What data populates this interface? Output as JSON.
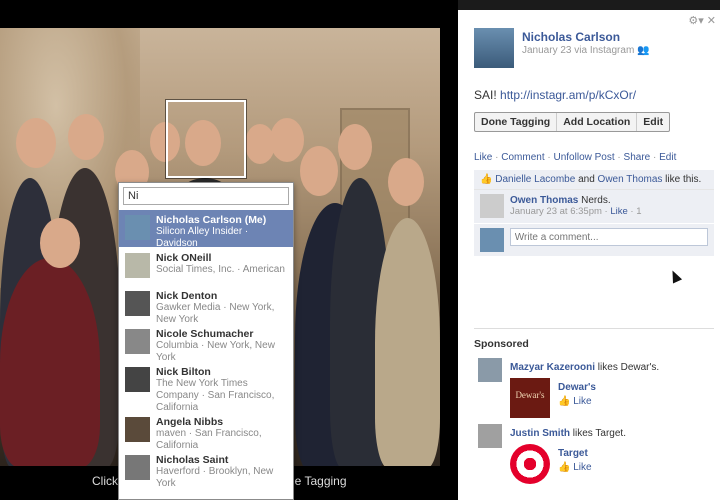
{
  "photo": {
    "caption_left": "Click",
    "caption_right": "ne Tagging"
  },
  "tag_dropdown": {
    "search_value": "Ni",
    "suggestions": [
      {
        "name": "Nicholas Carlson (Me)",
        "sub": "Silicon Alley Insider · Davidson"
      },
      {
        "name": "Nick ONeill",
        "sub": "Social Times, Inc. · American"
      },
      {
        "name": "Nick Denton",
        "sub": "Gawker Media · New York, New York"
      },
      {
        "name": "Nicole Schumacher",
        "sub": "Columbia · New York, New York"
      },
      {
        "name": "Nick Bilton",
        "sub": "The New York Times Company · San Francisco, California"
      },
      {
        "name": "Angela Nibbs",
        "sub": "maven · San Francisco, California"
      },
      {
        "name": "Nicholas Saint",
        "sub": "Haverford · Brooklyn, New York"
      }
    ]
  },
  "side": {
    "top_icons": "⚙▾  ✕",
    "author": "Nicholas Carlson",
    "meta": "January 23 via Instagram",
    "post_prefix": "SAI! ",
    "post_link": "http://instagr.am/p/kCxOr/",
    "buttons": [
      "Done Tagging",
      "Add Location",
      "Edit"
    ],
    "actions": [
      "Like",
      "Comment",
      "Unfollow Post",
      "Share",
      "Edit"
    ],
    "likes": {
      "name1": "Danielle Lacombe",
      "and": " and ",
      "name2": "Owen Thomas",
      "rest": " like this."
    },
    "comment": {
      "author": "Owen Thomas",
      "text": " Nerds.",
      "time": "January 23 at 6:35pm · ",
      "like": "Like",
      "count": " · 1"
    },
    "write_placeholder": "Write a comment...",
    "sponsored_title": "Sponsored",
    "ads": [
      {
        "actor": "Mazyar Kazerooni",
        "verb": " likes Dewar's.",
        "page": "Dewar's",
        "like": "Like",
        "logo_text": "Dewar's"
      },
      {
        "actor": "Justin Smith",
        "verb": " likes Target.",
        "page": "Target",
        "like": "Like"
      }
    ]
  }
}
